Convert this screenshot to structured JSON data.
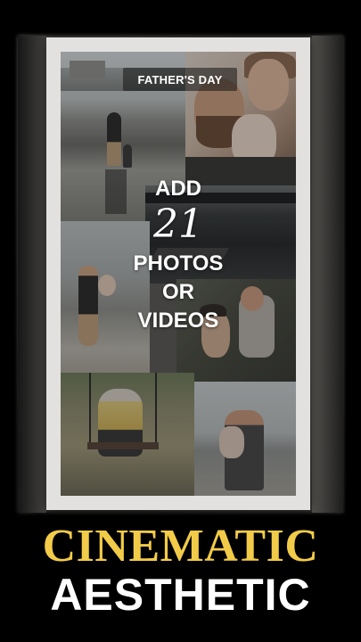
{
  "template": {
    "tag_label": "FATHER'S DAY",
    "cta": {
      "line1": "ADD",
      "count": "21",
      "line3": "PHOTOS",
      "line4": "OR",
      "line5": "VIDEOS"
    }
  },
  "headline": {
    "line1": "CINEMATIC",
    "line2": "AESTHETIC"
  },
  "colors": {
    "accent": "#f2cb48",
    "text": "#ffffff",
    "background": "#000000"
  }
}
